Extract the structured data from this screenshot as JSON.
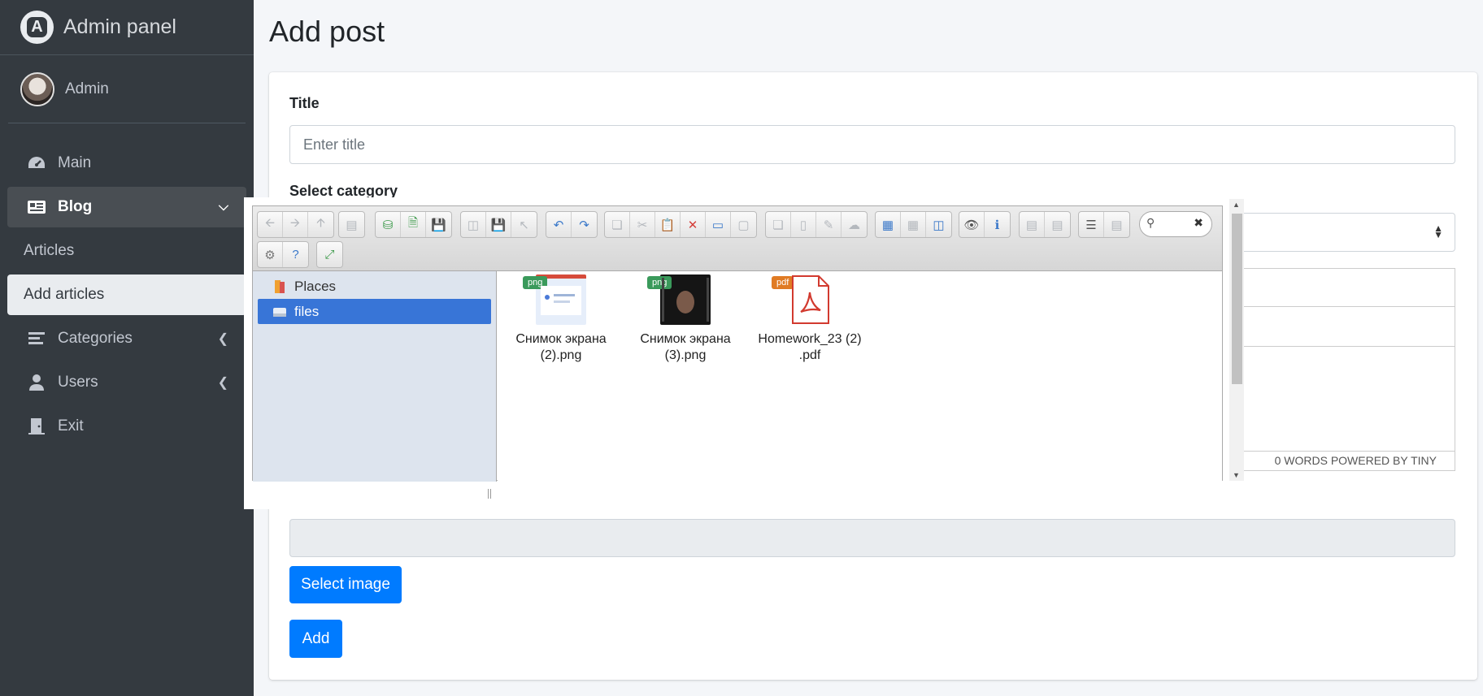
{
  "brand": {
    "title": "Admin panel"
  },
  "user": {
    "name": "Admin"
  },
  "sidebar": {
    "items": [
      {
        "label": "Main",
        "icon": "tachometer-icon"
      },
      {
        "label": "Blog",
        "icon": "newspaper-icon"
      },
      {
        "label": "Articles"
      },
      {
        "label": "Add articles"
      },
      {
        "label": "Categories",
        "icon": "list-icon"
      },
      {
        "label": "Users",
        "icon": "user-icon"
      },
      {
        "label": "Exit",
        "icon": "door-icon"
      }
    ]
  },
  "page": {
    "title": "Add post"
  },
  "form": {
    "title_label": "Title",
    "title_placeholder": "Enter title",
    "category_label": "Select category",
    "editor_status": "0 WORDS  POWERED BY TINY",
    "select_image_label": "Select image",
    "add_label": "Add"
  },
  "file_manager": {
    "tree": [
      {
        "label": "Places",
        "icon": "places-icon"
      },
      {
        "label": "files",
        "icon": "drive-icon",
        "selected": true
      }
    ],
    "files": [
      {
        "name_line1": "Снимок экрана",
        "name_line2": "(2).png",
        "type": "png"
      },
      {
        "name_line1": "Снимок экрана",
        "name_line2": "(3).png",
        "type": "png"
      },
      {
        "name_line1": "Homework_23 (2)",
        "name_line2": ".pdf",
        "type": "pdf"
      }
    ]
  },
  "colors": {
    "sidebar_bg": "#343a40",
    "primary": "#007bff",
    "tree_selected": "#3875d7",
    "png_badge": "#3a9a5b",
    "pdf_badge": "#e07b24"
  }
}
